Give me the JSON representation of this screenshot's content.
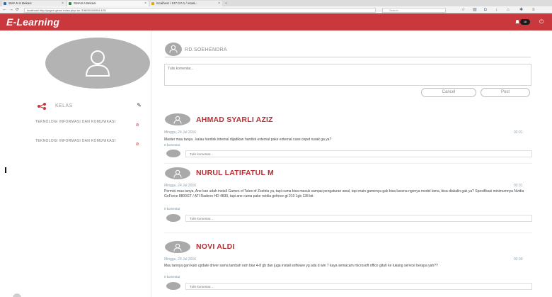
{
  "browser": {
    "tabs": [
      {
        "title": "SMA N 6 Bekasi",
        "color": "#2b6cb0"
      },
      {
        "title": "SMAN 6 Bekasi",
        "color": "#2b8a3e"
      },
      {
        "title": "localhost / 127.0.0.1 / smak...",
        "color": "#e0a800"
      }
    ],
    "url": "localhost/ http://yoger/ geno/ index.php/ on /198/5010/69/4 4/31",
    "search_placeholder": "Search",
    "icons": [
      "star-icon",
      "bookmark-icon",
      "pocket-icon",
      "download-icon",
      "home-icon",
      "menu-icon"
    ]
  },
  "app": {
    "brand": "E-Learning",
    "notif_count": "16",
    "accent": "#c9383d"
  },
  "sidebar": {
    "kelas_label": "KELAS",
    "classes": [
      {
        "name": "TEKNOLOGI INFORMASI DAN KOMUNIKASI"
      },
      {
        "name": "TEKNOLOGI INFORMASI DAN KOMUNIKASI"
      }
    ]
  },
  "composer": {
    "user_name": "RD.SOEHENDRA",
    "placeholder": "Tulis komentar...",
    "cancel_label": "Cancel",
    "post_label": "Post"
  },
  "posts": [
    {
      "author": "AHMAD SYARLI AZIZ",
      "date": "Minggu, 24 Jul 2016",
      "time": "02:31",
      "text": "Master mau tanya.. kalau hardisk internal dijadikan hardisk external pake external case cepet rusak ga ya?",
      "comment_count": "0 komentar",
      "comment_placeholder": "Tulis komentar..."
    },
    {
      "author": "NURUL LATIFATUL M",
      "date": "Minggu, 24 Jul 2016",
      "time": "02:31",
      "text": "Permisi mau tanya, Ane kan udah install Games of Tales of Zestiria ya, tapi cuma bisa masuk sampai pengaturan awal, tapi main gamenya gak bisa karena ngenya model lama, bisa diakalin gak ya? Spesifikasi minimumnya Nvidia GeForce 8800GT / ATI Radeon HD 4830, tapi ane cuma pake nvidia geforce gt 210 1gb 128 bit",
      "comment_count": "0 komentar",
      "comment_placeholder": "Tulis komentar..."
    },
    {
      "author": "NOVI ALDI",
      "date": "Minggu, 24 Jul 2016",
      "time": "02:30",
      "text": "Mau tannya gan kalo update driver sama tambah ram biar 4-8 gb dan juga install software yg ada d win 7 kaya semacam microsoft office gituh ke lukang service berapa yah??",
      "comment_count": "0 komentar",
      "comment_placeholder": "Tulis komentar..."
    }
  ]
}
